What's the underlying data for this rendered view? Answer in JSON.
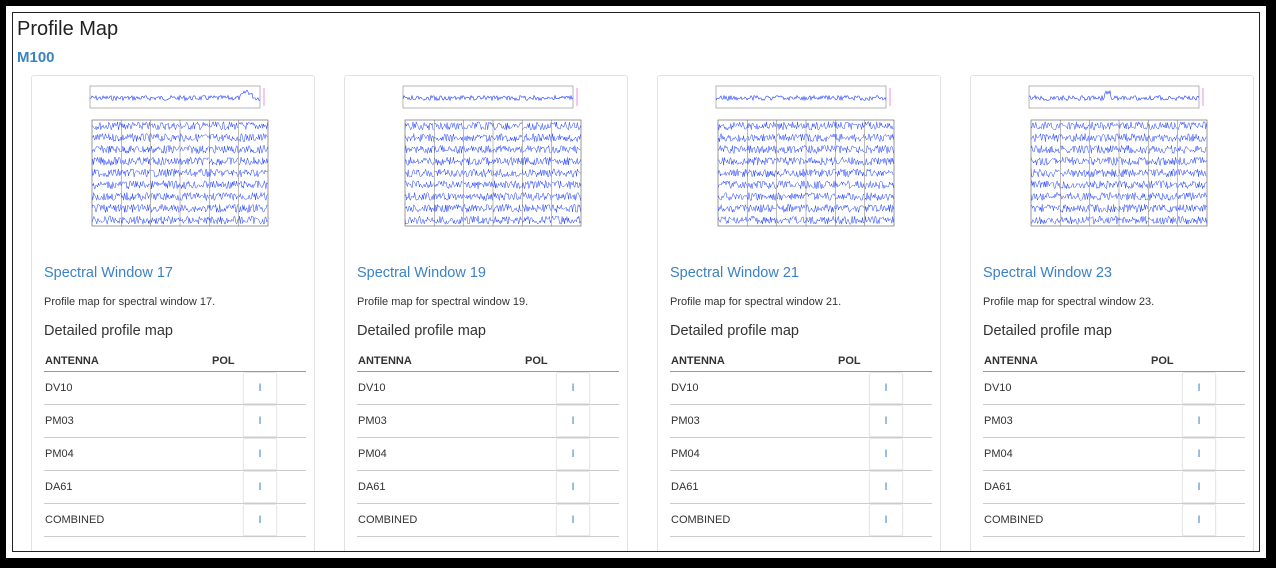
{
  "page": {
    "title": "Profile Map",
    "subtitle": "M100"
  },
  "cards": [
    {
      "title": "Spectral Window 17",
      "description": "Profile map for spectral window 17.",
      "detail_title": "Detailed profile map",
      "columns": [
        "ANTENNA",
        "POL"
      ],
      "rows": [
        {
          "antenna": "DV10",
          "pol": "I"
        },
        {
          "antenna": "PM03",
          "pol": "I"
        },
        {
          "antenna": "PM04",
          "pol": "I"
        },
        {
          "antenna": "DA61",
          "pol": "I"
        },
        {
          "antenna": "COMBINED",
          "pol": "I"
        }
      ]
    },
    {
      "title": "Spectral Window 19",
      "description": "Profile map for spectral window 19.",
      "detail_title": "Detailed profile map",
      "columns": [
        "ANTENNA",
        "POL"
      ],
      "rows": [
        {
          "antenna": "DV10",
          "pol": "I"
        },
        {
          "antenna": "PM03",
          "pol": "I"
        },
        {
          "antenna": "PM04",
          "pol": "I"
        },
        {
          "antenna": "DA61",
          "pol": "I"
        },
        {
          "antenna": "COMBINED",
          "pol": "I"
        }
      ]
    },
    {
      "title": "Spectral Window 21",
      "description": "Profile map for spectral window 21.",
      "detail_title": "Detailed profile map",
      "columns": [
        "ANTENNA",
        "POL"
      ],
      "rows": [
        {
          "antenna": "DV10",
          "pol": "I"
        },
        {
          "antenna": "PM03",
          "pol": "I"
        },
        {
          "antenna": "PM04",
          "pol": "I"
        },
        {
          "antenna": "DA61",
          "pol": "I"
        },
        {
          "antenna": "COMBINED",
          "pol": "I"
        }
      ]
    },
    {
      "title": "Spectral Window 23",
      "description": "Profile map for spectral window 23.",
      "detail_title": "Detailed profile map",
      "columns": [
        "ANTENNA",
        "POL"
      ],
      "rows": [
        {
          "antenna": "DV10",
          "pol": "I"
        },
        {
          "antenna": "PM03",
          "pol": "I"
        },
        {
          "antenna": "PM04",
          "pol": "I"
        },
        {
          "antenna": "DA61",
          "pol": "I"
        },
        {
          "antenna": "COMBINED",
          "pol": "I"
        }
      ]
    }
  ],
  "colors": {
    "accent": "#3b82c4",
    "plot_line": "#1f3fff",
    "plot_marker": "#e040e0"
  }
}
